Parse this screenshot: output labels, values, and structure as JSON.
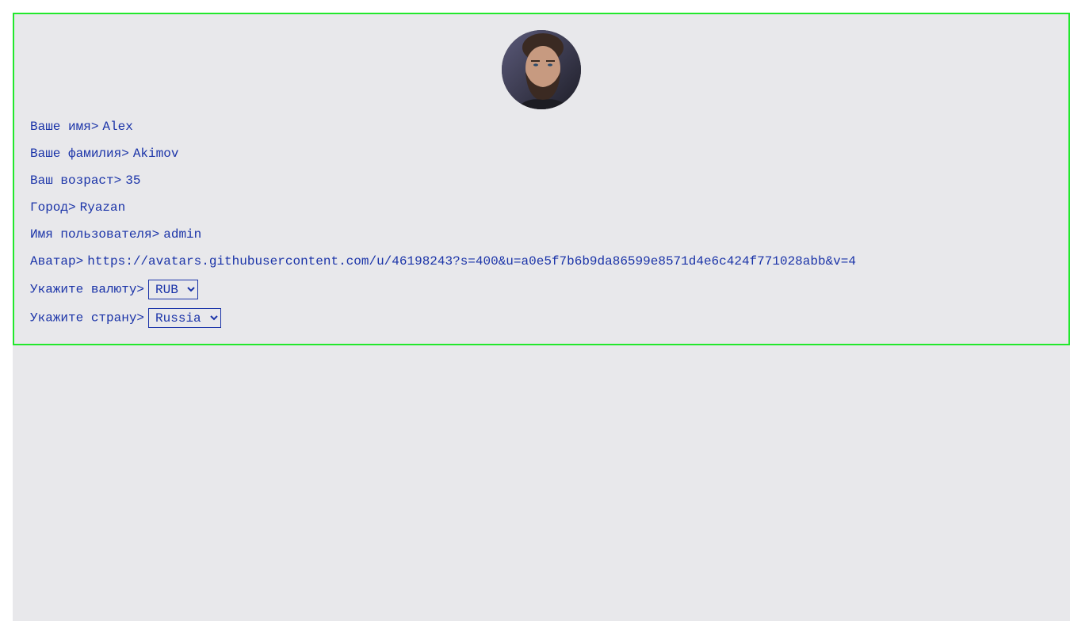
{
  "profile": {
    "avatar_icon": "user-photo",
    "fields": {
      "first_name": {
        "label": "Ваше имя>",
        "value": "Alex"
      },
      "last_name": {
        "label": "Ваше фамилия>",
        "value": "Akimov"
      },
      "age": {
        "label": "Ваш возраст>",
        "value": "35"
      },
      "city": {
        "label": "Город>",
        "value": "Ryazan"
      },
      "username": {
        "label": "Имя пользователя>",
        "value": "admin"
      },
      "avatar_url": {
        "label": "Аватар>",
        "value": "https://avatars.githubusercontent.com/u/46198243?s=400&u=a0e5f7b6b9da86599e8571d4e6c424f771028abb&v=4"
      }
    },
    "currency": {
      "label": "Укажите валюту>",
      "selected": "RUB"
    },
    "country": {
      "label": "Укажите страну>",
      "selected": "Russia"
    }
  },
  "colors": {
    "text": "#1a33a8",
    "card_border": "#22e82c",
    "background": "#e8e8eb"
  }
}
